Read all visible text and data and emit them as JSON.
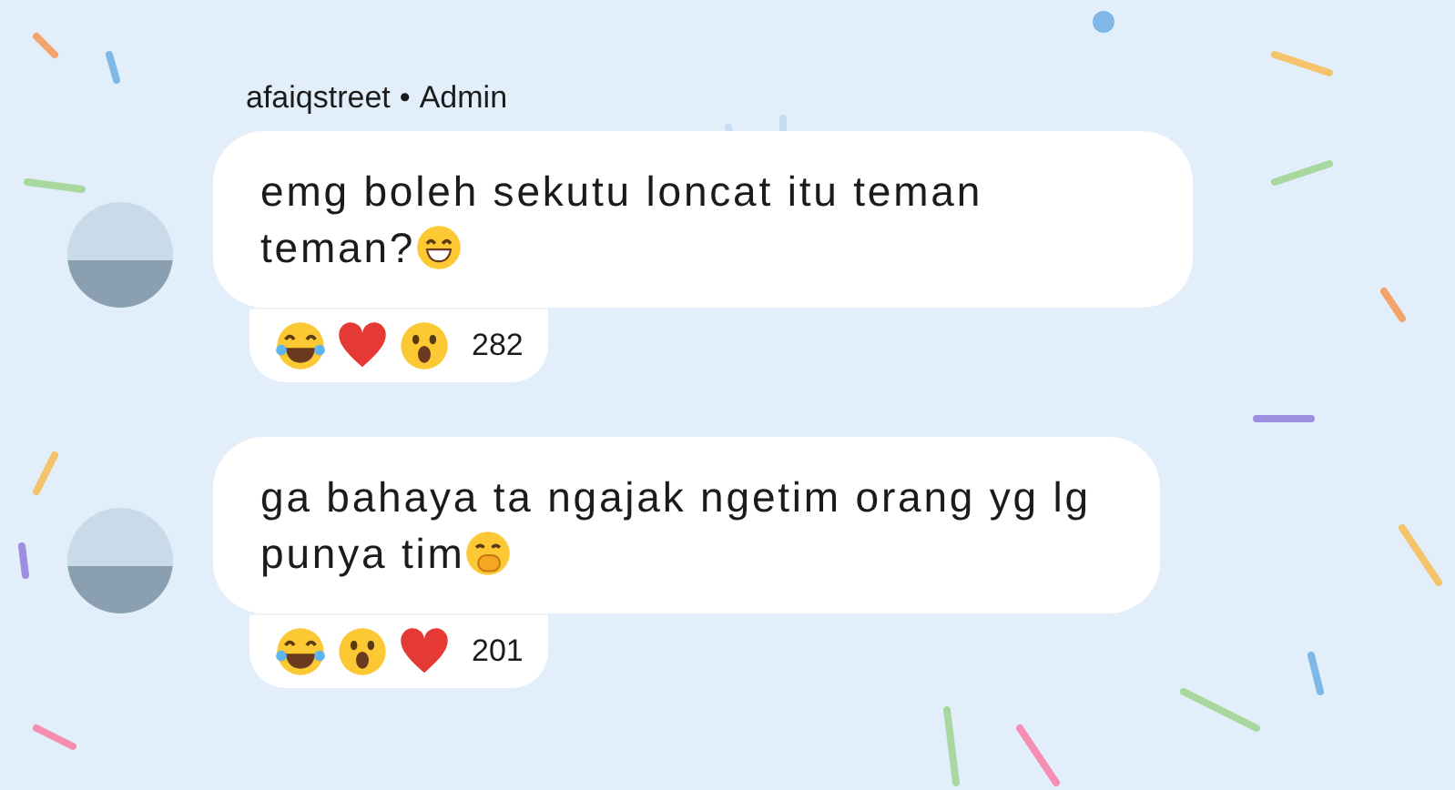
{
  "sender": {
    "name": "afaiqstreet",
    "separator": "•",
    "role": "Admin"
  },
  "messages": [
    {
      "text": "emg boleh sekutu loncat itu teman teman?",
      "trailing_icon": {
        "kind": "grin"
      },
      "reactions": [
        {
          "kind": "laugh"
        },
        {
          "kind": "heart"
        },
        {
          "kind": "wow"
        }
      ],
      "count": "282"
    },
    {
      "text": "ga bahaya ta ngajak ngetim orang yg lg punya tim",
      "trailing_icon": {
        "kind": "hand-over-mouth"
      },
      "reactions": [
        {
          "kind": "laugh"
        },
        {
          "kind": "wow"
        },
        {
          "kind": "heart"
        }
      ],
      "count": "201"
    }
  ]
}
